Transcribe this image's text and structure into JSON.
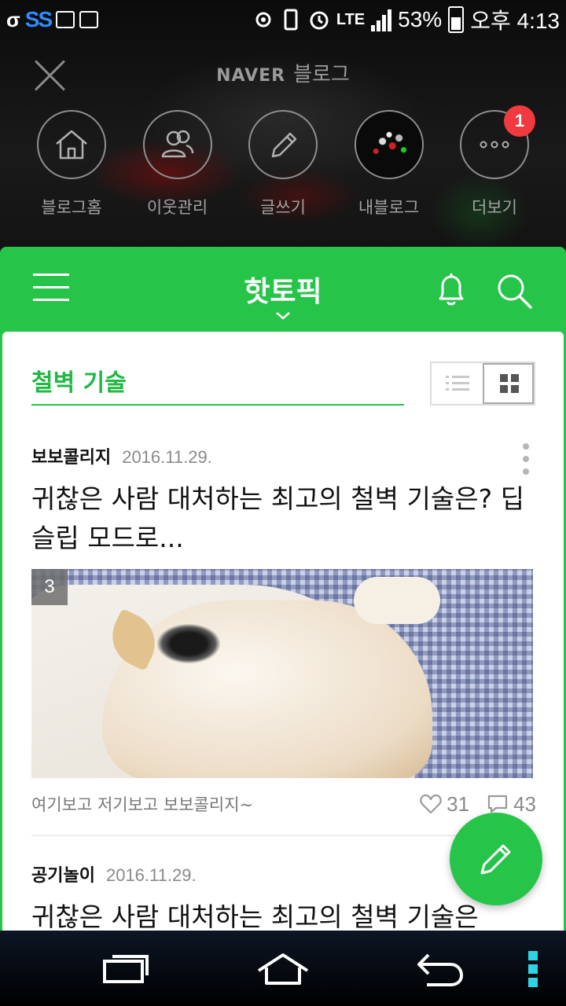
{
  "status_bar": {
    "left_glyph": "σ",
    "ss_text": "SS",
    "network": "LTE",
    "battery": "53%",
    "time": "오후 4:13"
  },
  "header": {
    "brand_naver": "NAVER",
    "brand_blog": "블로그"
  },
  "quick_menu": [
    {
      "label": "블로그홈",
      "icon": "home-icon"
    },
    {
      "label": "이웃관리",
      "icon": "neighbors-icon"
    },
    {
      "label": "글쓰기",
      "icon": "pencil-icon"
    },
    {
      "label": "내블로그",
      "icon": "my-blog-avatar"
    },
    {
      "label": "더보기",
      "icon": "more-icon",
      "badge": "1"
    }
  ],
  "topbar": {
    "title": "핫토픽"
  },
  "topic": {
    "title": "철벽 기술"
  },
  "posts": [
    {
      "author": "보보콜리지",
      "date": "2016.11.29.",
      "title": "귀찮은 사람 대처하는 최고의 철벽 기술은? 딥슬립 모드로...",
      "image_count": "3",
      "summary": "여기보고 저기보고 보보콜리지~",
      "likes": "31",
      "comments": "43"
    },
    {
      "author": "공기놀이",
      "date": "2016.11.29.",
      "title": "귀찮은 사람 대처하는 최고의 철벽 기술은"
    }
  ],
  "colors": {
    "accent": "#27c44a",
    "badge": "#f03a40"
  }
}
